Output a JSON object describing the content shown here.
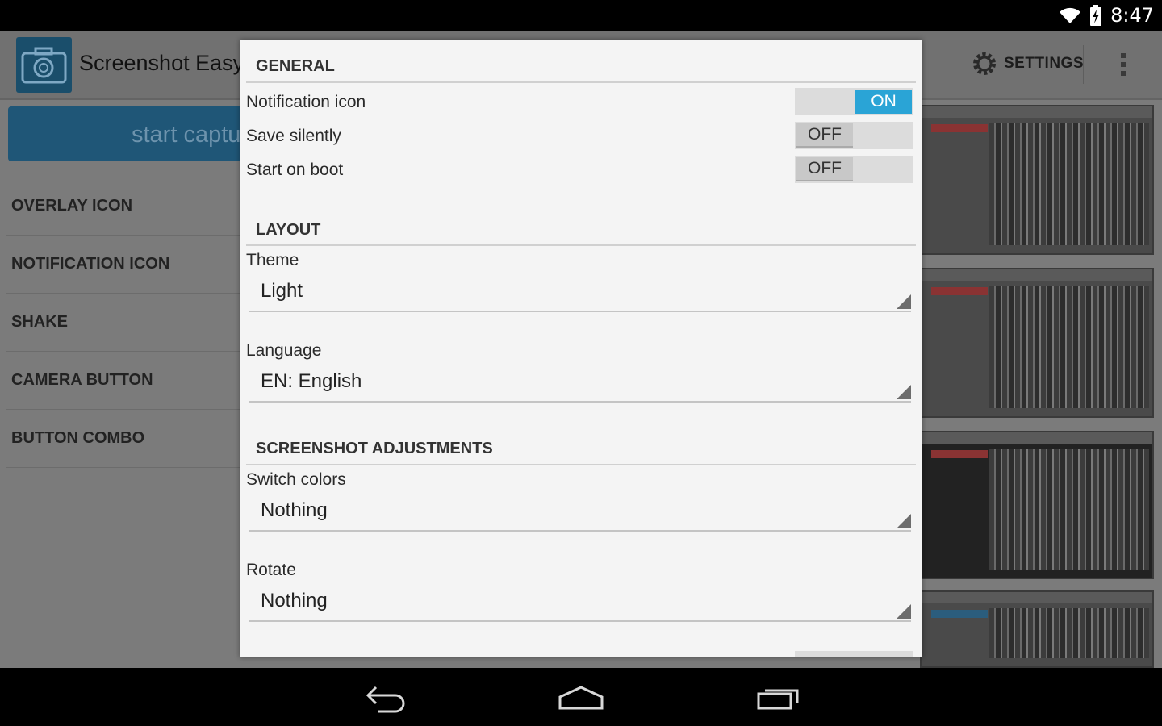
{
  "status_bar": {
    "time": "8:47",
    "icons": [
      "wifi-icon",
      "battery-charging-icon"
    ]
  },
  "app": {
    "title": "Screenshot Easy",
    "settings_label": "SETTINGS",
    "capture_button": "start captu",
    "menu_items": [
      "OVERLAY ICON",
      "NOTIFICATION ICON",
      "SHAKE",
      "CAMERA BUTTON",
      "BUTTON COMBO"
    ]
  },
  "dialog": {
    "general": {
      "header": "GENERAL",
      "rows": [
        {
          "label": "Notification icon",
          "state": "ON"
        },
        {
          "label": "Save silently",
          "state": "OFF"
        },
        {
          "label": "Start on boot",
          "state": "OFF"
        }
      ]
    },
    "layout": {
      "header": "LAYOUT",
      "theme_label": "Theme",
      "theme_value": "Light",
      "language_label": "Language",
      "language_value": "EN: English"
    },
    "adjustments": {
      "header": "SCREENSHOT ADJUSTMENTS",
      "switch_colors_label": "Switch colors",
      "switch_colors_value": "Nothing",
      "rotate_label": "Rotate",
      "rotate_value": "Nothing"
    }
  },
  "colors": {
    "accent": "#2aa4d6",
    "capture_button": "#1f5677",
    "dim_background": "#7b7b7b"
  }
}
